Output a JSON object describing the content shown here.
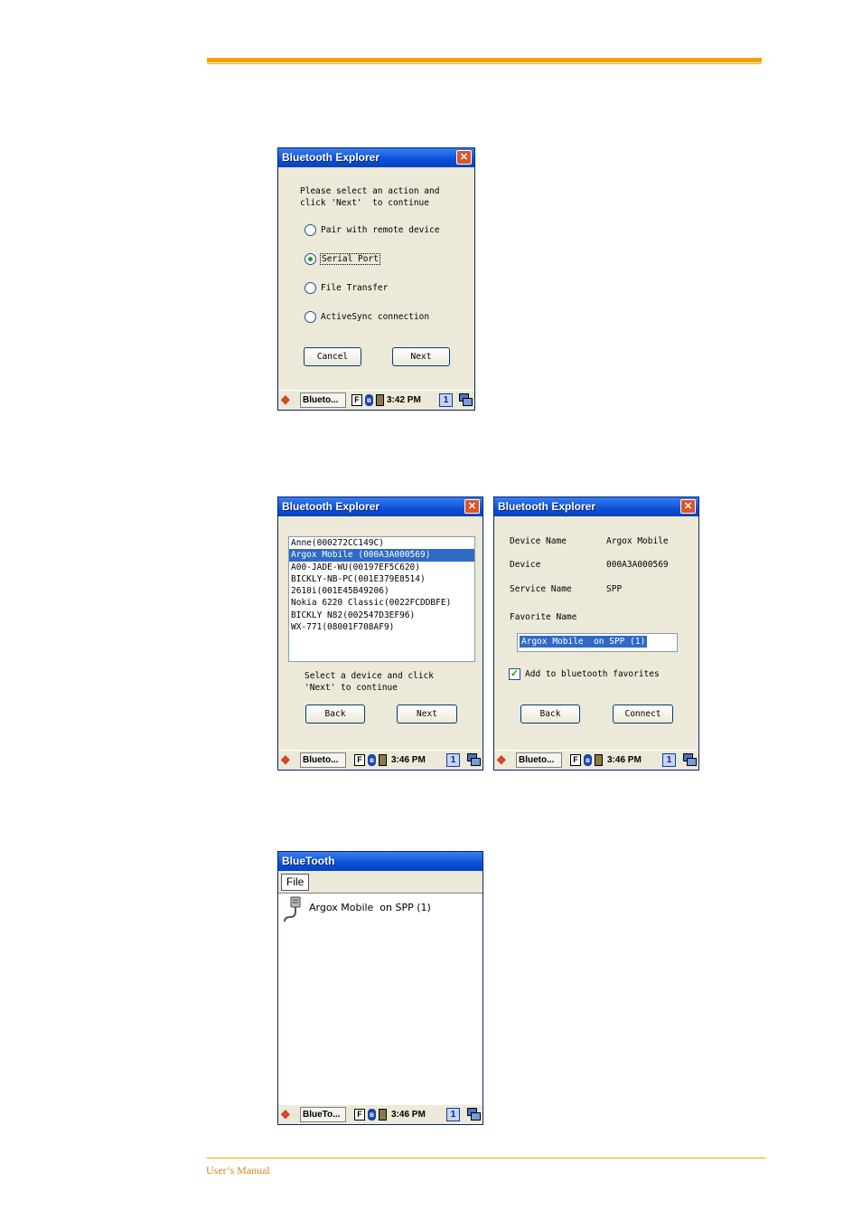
{
  "footer": "User’s Manual",
  "dialog1": {
    "title": "Bluetooth Explorer",
    "close": "✕",
    "instruction_line1": "Please select an action and",
    "instruction_line2": "click 'Next'  to continue",
    "options": [
      "Pair with remote device",
      "Serial Port",
      "File Transfer",
      "ActiveSync connection"
    ],
    "selected_option": "Serial Port",
    "cancel": "Cancel",
    "next": "Next",
    "taskbar": {
      "task": "Blueto...",
      "f": "F",
      "bt": "ʙ",
      "time": "3:42 PM",
      "desktop": "1"
    }
  },
  "dialog2": {
    "title": "Bluetooth Explorer",
    "close": "✕",
    "devices": [
      "Anne(000272CC149C)",
      "Argox Mobile (000A3A000569)",
      "A00-JADE-WU(00197EF5C620)",
      "BICKLY-NB-PC(001E379E8514)",
      "2610i(001E45B49206)",
      "Nokia 6220 Classic(0022FCDDBFE)",
      "BICKLY N82(002547D3EF96)",
      "WX-771(08001F708AF9)"
    ],
    "selected_device": "Argox Mobile (000A3A000569)",
    "instruction_line1": "Select a device and click",
    "instruction_line2": "'Next' to continue",
    "back": "Back",
    "next": "Next",
    "taskbar": {
      "task": "Blueto...",
      "f": "F",
      "bt": "ʙ",
      "time": "3:46 PM",
      "desktop": "1"
    }
  },
  "dialog3": {
    "title": "Bluetooth Explorer",
    "close": "✕",
    "device_name_label": "Device Name",
    "device_name_value": "Argox Mobile",
    "device_label": "Device",
    "device_value": "000A3A000569",
    "service_name_label": "Service Name",
    "service_name_value": "SPP",
    "favorite_name_label": "Favorite Name",
    "favorite_name_value": "Argox Mobile  on SPP (1)",
    "add_favorites": "Add to bluetooth favorites",
    "add_favorites_checked": true,
    "back": "Back",
    "connect": "Connect",
    "taskbar": {
      "task": "Blueto...",
      "f": "F",
      "bt": "ʙ",
      "time": "3:46 PM",
      "desktop": "1"
    }
  },
  "window4": {
    "title": "BlueTooth",
    "menu_file": "File",
    "item": "Argox Mobile  on SPP (1)",
    "taskbar": {
      "task": "BlueTo...",
      "f": "F",
      "bt": "ʙ",
      "time": "3:46 PM",
      "desktop": "1"
    }
  }
}
